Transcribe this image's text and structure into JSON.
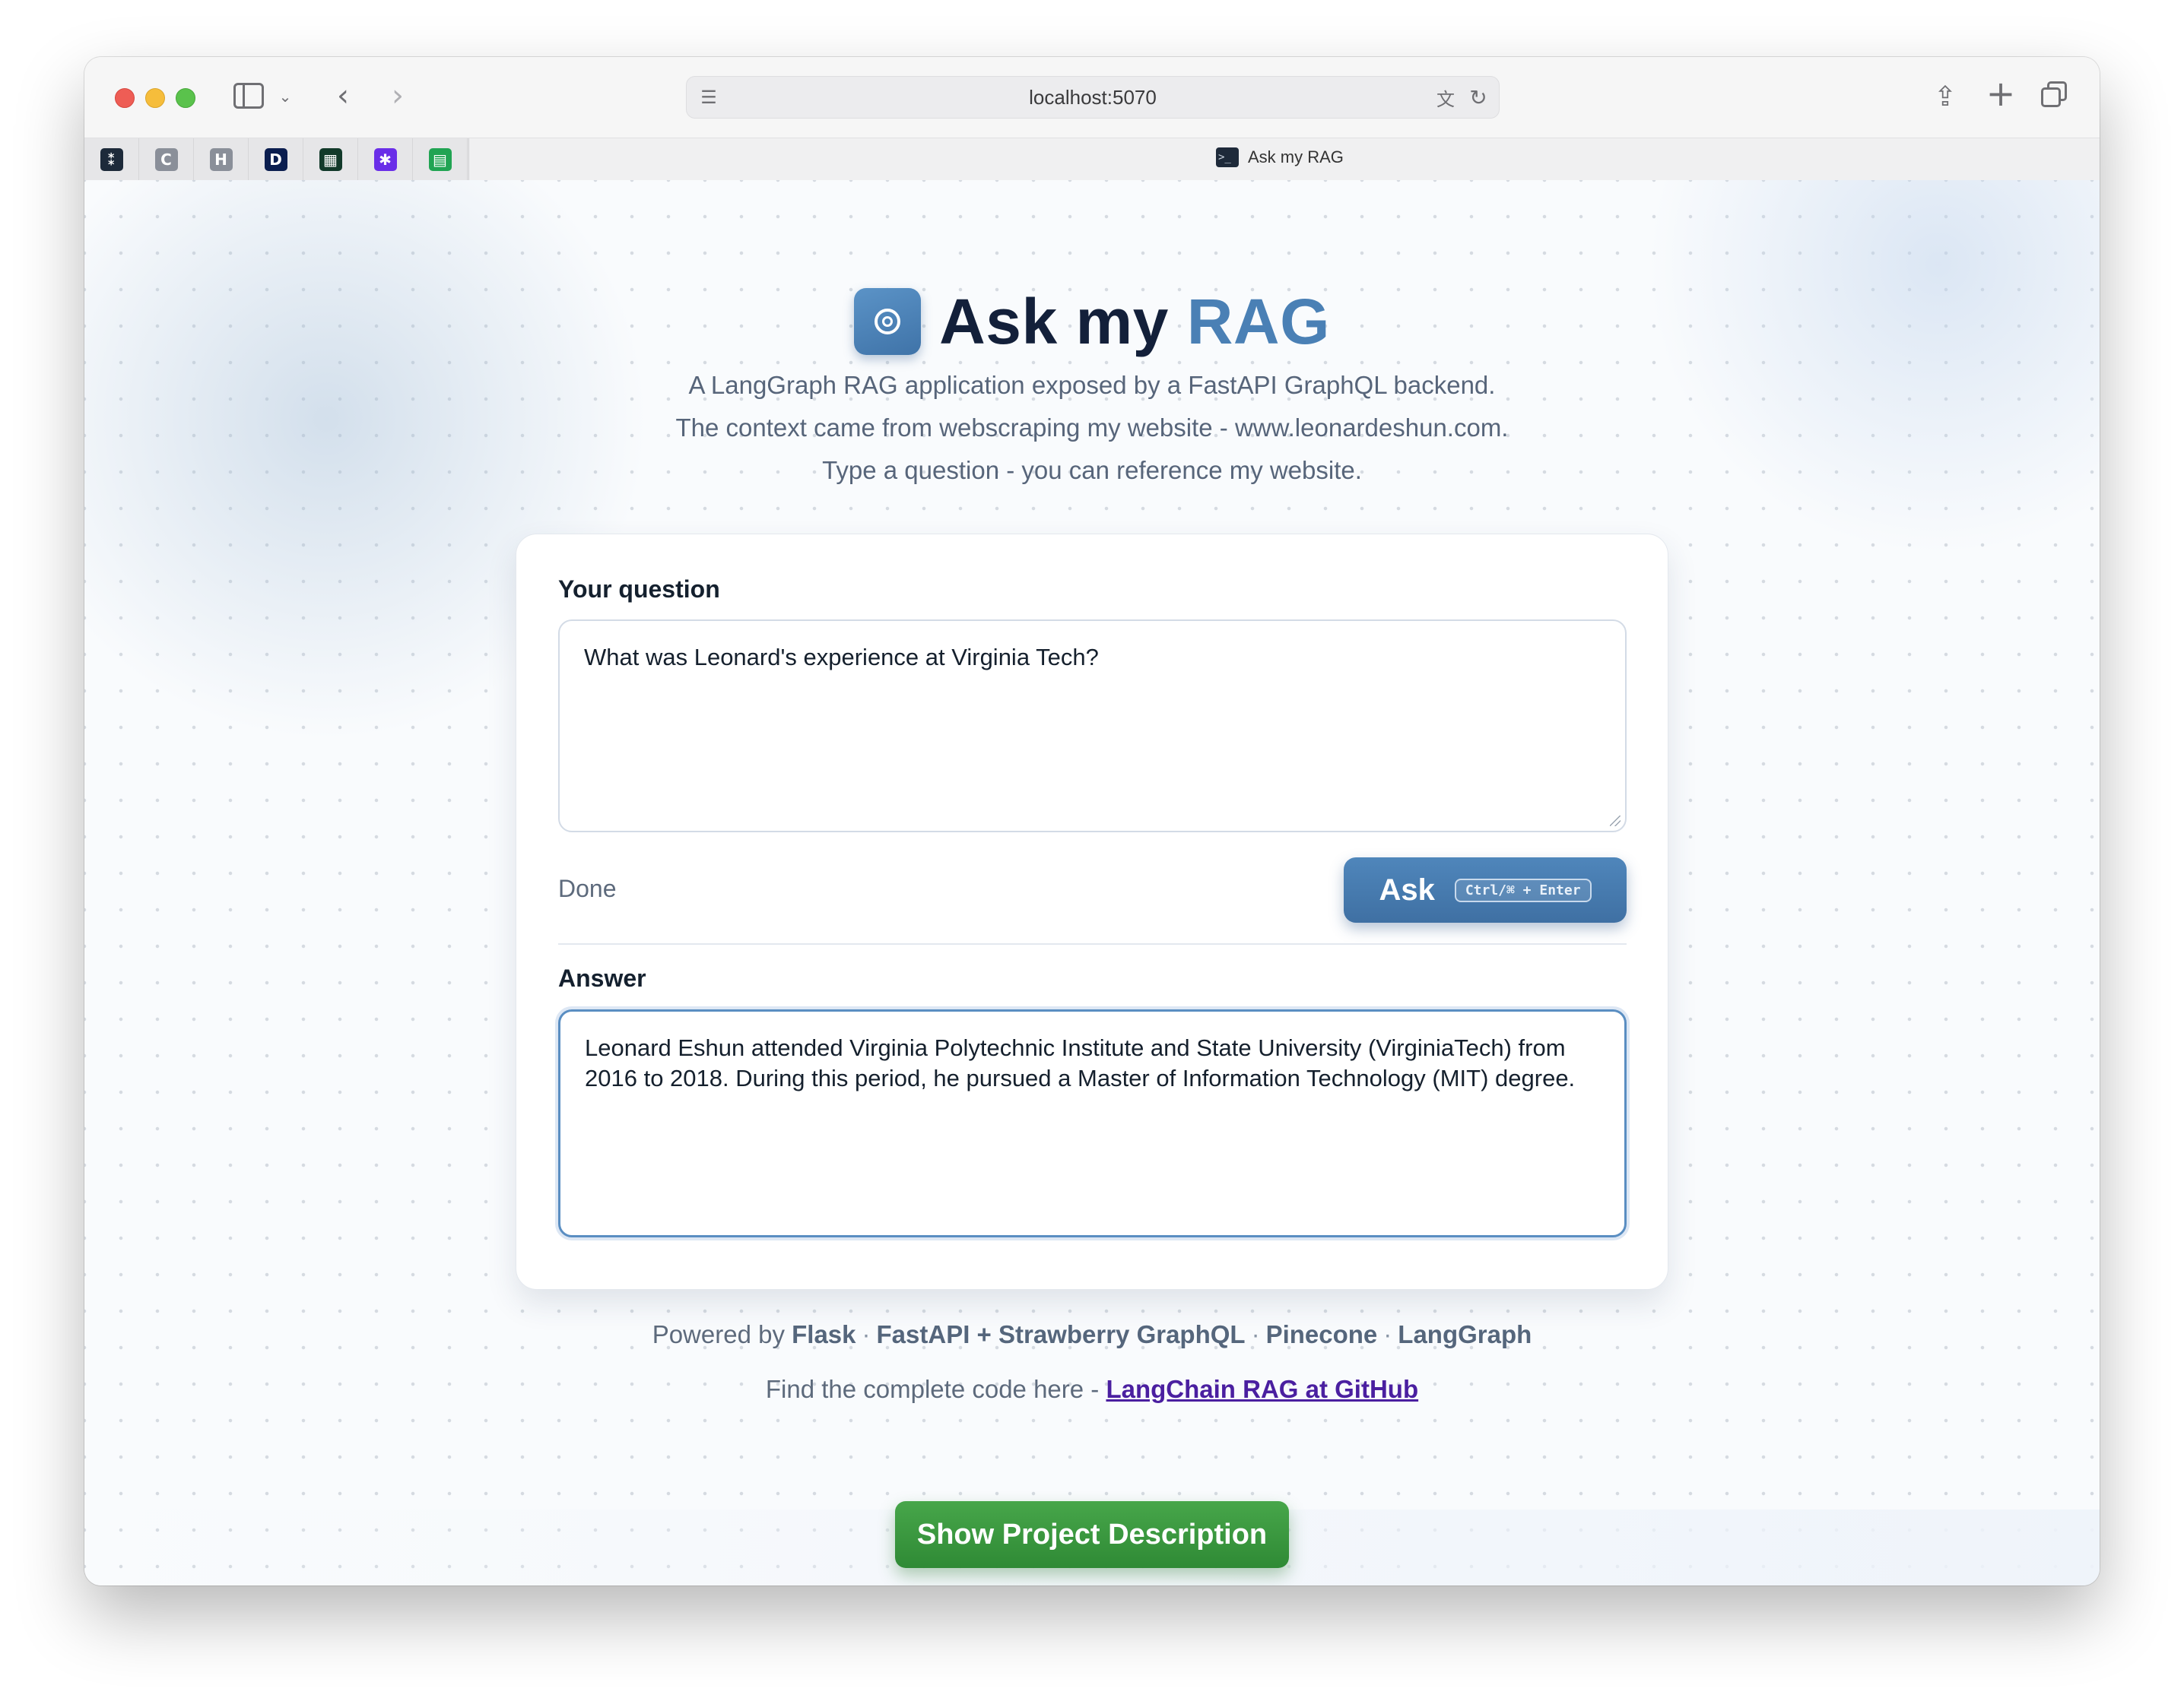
{
  "browser": {
    "url": "localhost:5070",
    "active_tab_title": "Ask my RAG",
    "pinned_tabs": [
      {
        "icon": "sparkle-icon",
        "glyph": "⁑",
        "color": "#1d2a3a"
      },
      {
        "icon": "c-letter-icon",
        "glyph": "C",
        "color": "#8a8f99"
      },
      {
        "icon": "h-letter-icon",
        "glyph": "H",
        "color": "#8a8f99"
      },
      {
        "icon": "d-letter-icon",
        "glyph": "D",
        "color": "#0b1e4f"
      },
      {
        "icon": "grid-icon",
        "glyph": "▦",
        "color": "#123a2a"
      },
      {
        "icon": "star-circle-icon",
        "glyph": "✱",
        "color": "#6a2ee8"
      },
      {
        "icon": "sheet-icon",
        "glyph": "▤",
        "color": "#21a453"
      }
    ]
  },
  "header": {
    "title_main": "Ask my",
    "title_accent": "RAG",
    "subtitle_lines": [
      "A LangGraph RAG application exposed by a FastAPI GraphQL backend.",
      "The context came from webscraping my website - www.leonardeshun.com.",
      "Type a question - you can reference my website."
    ]
  },
  "form": {
    "question_label": "Your question",
    "question_value": "What was Leonard's experience at Virginia Tech?",
    "status": "Done",
    "ask_label": "Ask",
    "ask_shortcut": "Ctrl/⌘ + Enter",
    "answer_label": "Answer",
    "answer_value": "Leonard Eshun attended Virginia Polytechnic Institute and State University (VirginiaTech) from 2016 to 2018. During this period, he pursued a Master of Information Technology (MIT) degree."
  },
  "footer": {
    "powered_prefix": "Powered by",
    "tech": [
      "Flask",
      "FastAPI + Strawberry GraphQL",
      "Pinecone",
      "LangGraph"
    ],
    "separator": "·",
    "find_prefix": "Find the complete code here -",
    "github_link_text": "LangChain RAG at GitHub"
  },
  "project_button_label": "Show Project Description",
  "colors": {
    "accent": "#4a80b5",
    "ask_button": "#4479ad",
    "project_button": "#3a9a3f",
    "link": "#4a1fa0"
  }
}
